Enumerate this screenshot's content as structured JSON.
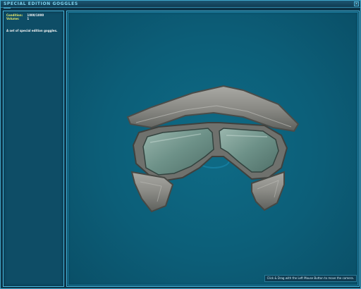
{
  "window": {
    "title": "SPECIAL EDITION GOGGLES",
    "close_glyph": "×"
  },
  "info": {
    "condition_label": "Condition:",
    "condition_value": "1000/1000",
    "volume_label": "Volume:",
    "volume_value": "1",
    "description": "A set of special edition goggles."
  },
  "viewer": {
    "hint": "Click & Drag with the Left Mouse Button to move the camera.",
    "model_icon": "goggles-model"
  },
  "colors": {
    "frame_accent": "#46b6dc",
    "label_yellow": "#e2e46a",
    "viewer_bg": "#0c5e78"
  }
}
